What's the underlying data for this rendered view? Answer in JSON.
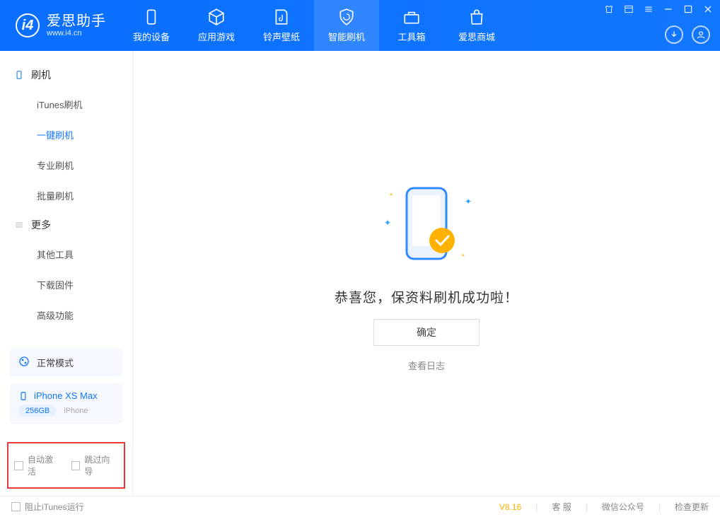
{
  "header": {
    "app_name": "爱思助手",
    "url": "www.i4.cn",
    "tabs": [
      {
        "label": "我的设备"
      },
      {
        "label": "应用游戏"
      },
      {
        "label": "铃声壁纸"
      },
      {
        "label": "智能刷机"
      },
      {
        "label": "工具箱"
      },
      {
        "label": "爱思商城"
      }
    ]
  },
  "sidebar": {
    "group1": {
      "title": "刷机"
    },
    "items1": [
      {
        "label": "iTunes刷机"
      },
      {
        "label": "一键刷机"
      },
      {
        "label": "专业刷机"
      },
      {
        "label": "批量刷机"
      }
    ],
    "group2": {
      "title": "更多"
    },
    "items2": [
      {
        "label": "其他工具"
      },
      {
        "label": "下载固件"
      },
      {
        "label": "高级功能"
      }
    ],
    "status_mode": "正常模式",
    "device_name": "iPhone XS Max",
    "device_capacity": "256GB",
    "device_type": "iPhone",
    "opt_auto_activate": "自动激活",
    "opt_skip_guide": "跳过向导"
  },
  "main": {
    "success_text": "恭喜您，保资料刷机成功啦！",
    "ok_label": "确定",
    "view_log": "查看日志"
  },
  "footer": {
    "block_itunes": "阻止iTunes运行",
    "version": "V8.16",
    "support": "客 服",
    "wechat": "微信公众号",
    "update": "检查更新"
  }
}
